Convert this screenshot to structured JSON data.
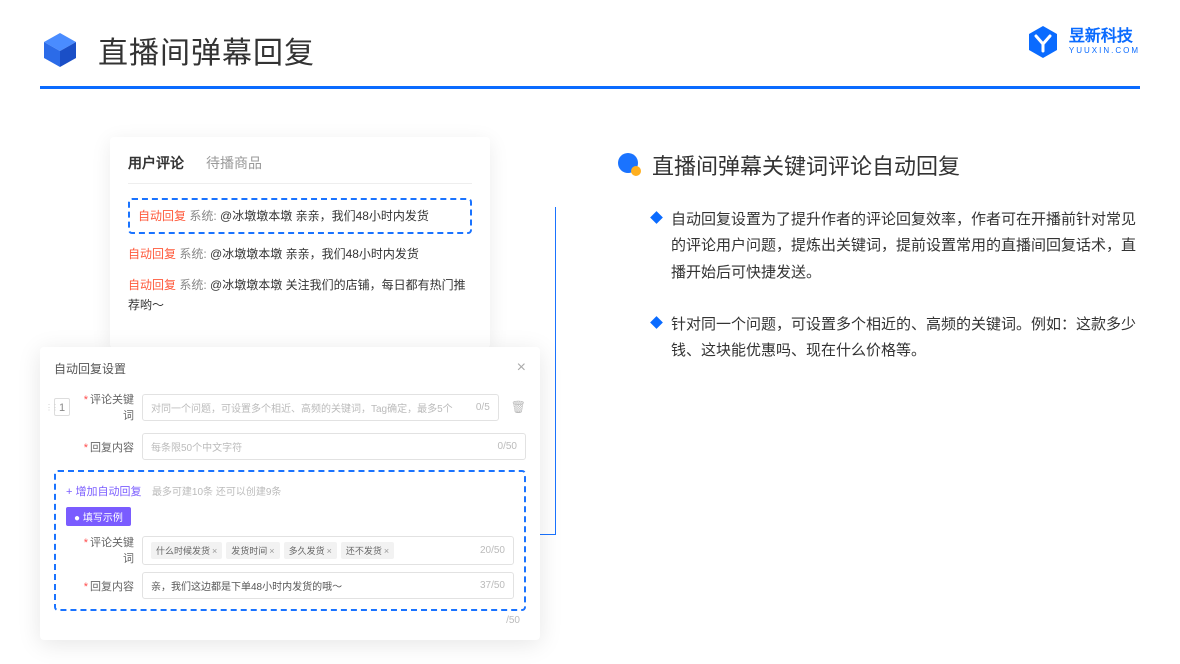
{
  "header": {
    "title": "直播间弹幕回复"
  },
  "brand": {
    "cn": "昱新科技",
    "en": "YUUXIN.COM"
  },
  "card1": {
    "tabs": [
      "用户评论",
      "待播商品"
    ],
    "comments": [
      {
        "tag": "自动回复",
        "sys": "系统:",
        "msg": "@冰墩墩本墩 亲亲，我们48小时内发货"
      },
      {
        "tag": "自动回复",
        "sys": "系统:",
        "msg": "@冰墩墩本墩 亲亲，我们48小时内发货"
      },
      {
        "tag": "自动回复",
        "sys": "系统:",
        "msg": "@冰墩墩本墩 关注我们的店铺，每日都有热门推荐哟～"
      }
    ]
  },
  "card2": {
    "title": "自动回复设置",
    "row1": {
      "num": "1",
      "label": "评论关键词",
      "placeholder": "对同一个问题，可设置多个相近、高频的关键词，Tag确定，最多5个",
      "count": "0/5"
    },
    "row2": {
      "label": "回复内容",
      "placeholder": "每条限50个中文字符",
      "count": "0/50"
    },
    "addLink": "+ 增加自动回复",
    "addHint": "最多可建10条 还可以创建9条",
    "badge": "● 填写示例",
    "ex1": {
      "label": "评论关键词",
      "chips": [
        "什么时候发货",
        "发货时间",
        "多久发货",
        "还不发货"
      ],
      "count": "20/50"
    },
    "ex2": {
      "label": "回复内容",
      "text": "亲，我们这边都是下单48小时内发货的哦～",
      "count": "37/50"
    },
    "bottomCount": "/50"
  },
  "right": {
    "title": "直播间弹幕关键词评论自动回复",
    "b1": "自动回复设置为了提升作者的评论回复效率，作者可在开播前针对常见的评论用户问题，提炼出关键词，提前设置常用的直播间回复话术，直播开始后可快捷发送。",
    "b2": "针对同一个问题，可设置多个相近的、高频的关键词。例如：这款多少钱、这块能优惠吗、现在什么价格等。"
  }
}
